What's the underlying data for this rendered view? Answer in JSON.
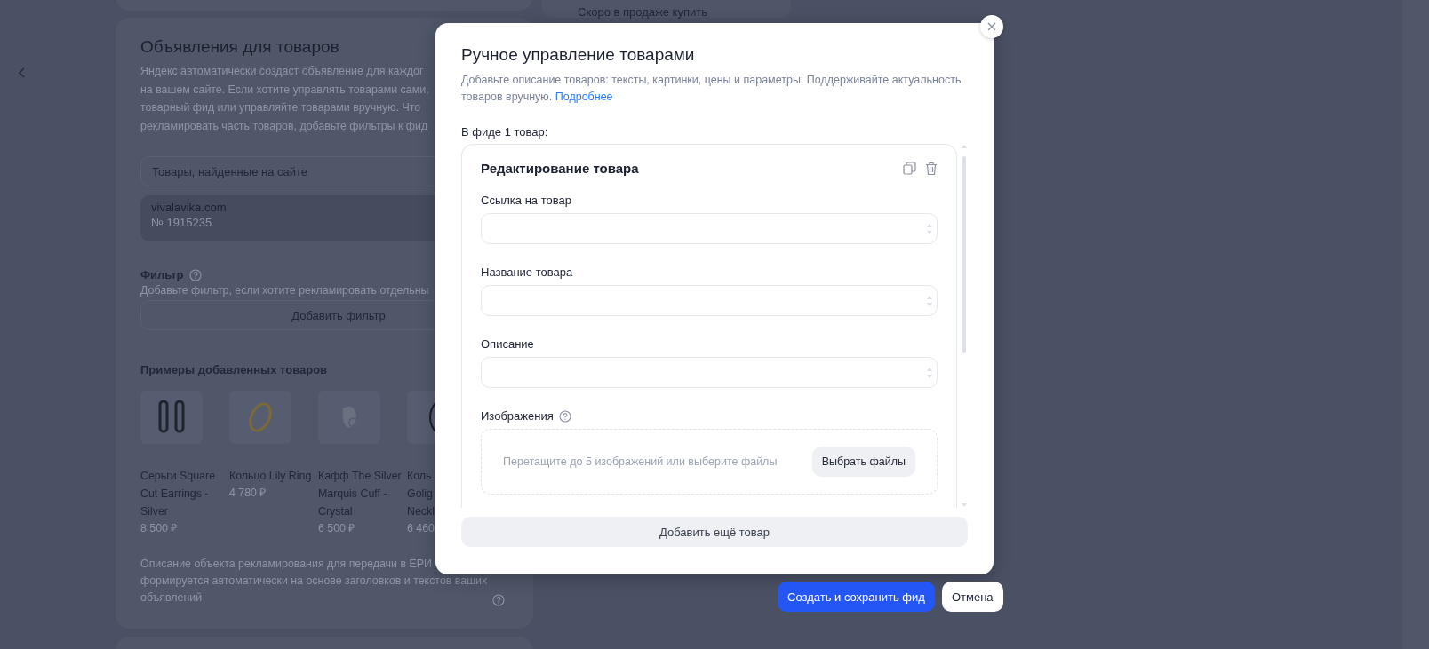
{
  "background": {
    "top_text": "Скоро в продаже купить",
    "card": {
      "title": "Объявления для товаров",
      "description_lines": [
        "Яндекс автоматически создаст объявление для каждог",
        "на вашем сайте. Если хотите управлять товарами сами,",
        "товарный фид или управляйте товарами вручную. Что",
        "рекламировать часть товаров, добавьте фильтры к фид"
      ],
      "source_select": "Товары, найденные на сайте",
      "site": {
        "domain": "vivalavika.com",
        "number": "№ 1915235"
      },
      "filter": {
        "label": "Фильтр",
        "hint": "Добавьте фильтр, если хотите рекламировать отдельны",
        "button": "Добавить фильтр"
      },
      "examples_title": "Примеры добавленных товаров",
      "products": [
        {
          "name_lines": [
            "Серьги Square",
            "Cut Earrings -",
            "Silver"
          ],
          "price": "8 500 ₽"
        },
        {
          "name_lines": [
            "Кольцо Lily Ring"
          ],
          "price": "4 780 ₽"
        },
        {
          "name_lines": [
            "Кафф The Silver",
            "Marquis Cuff -",
            "Crystal"
          ],
          "price": "6 500 ₽"
        },
        {
          "name_lines": [
            "Коль",
            "Golig",
            "Neckl"
          ],
          "price": "6 460"
        }
      ],
      "footnote_lines": [
        "Описание объекта рекламирования для передачи в ЕРИ",
        "формируется автоматически на основе заголовков и текстов ваших",
        "объявлений"
      ]
    }
  },
  "modal": {
    "title": "Ручное управление товарами",
    "description": "Добавьте описание товаров: тексты, картинки, цены и параметры. Поддерживайте актуальность товаров вручную.",
    "link": "Подробнее",
    "count_label": "В фиде 1 товар:",
    "item_card": {
      "title": "Редактирование товара",
      "fields": [
        {
          "label": "Ссылка на товар"
        },
        {
          "label": "Название товара"
        },
        {
          "label": "Описание"
        }
      ],
      "images": {
        "label": "Изображения",
        "dropzone_text": "Перетащите до 5 изображений или выберите файлы",
        "button": "Выбрать файлы"
      }
    },
    "add_button": "Добавить ещё товар"
  },
  "actions": [
    {
      "label": "Создать и сохранить фид",
      "kind": "primary"
    },
    {
      "label": "Отмена",
      "kind": "secondary"
    }
  ]
}
